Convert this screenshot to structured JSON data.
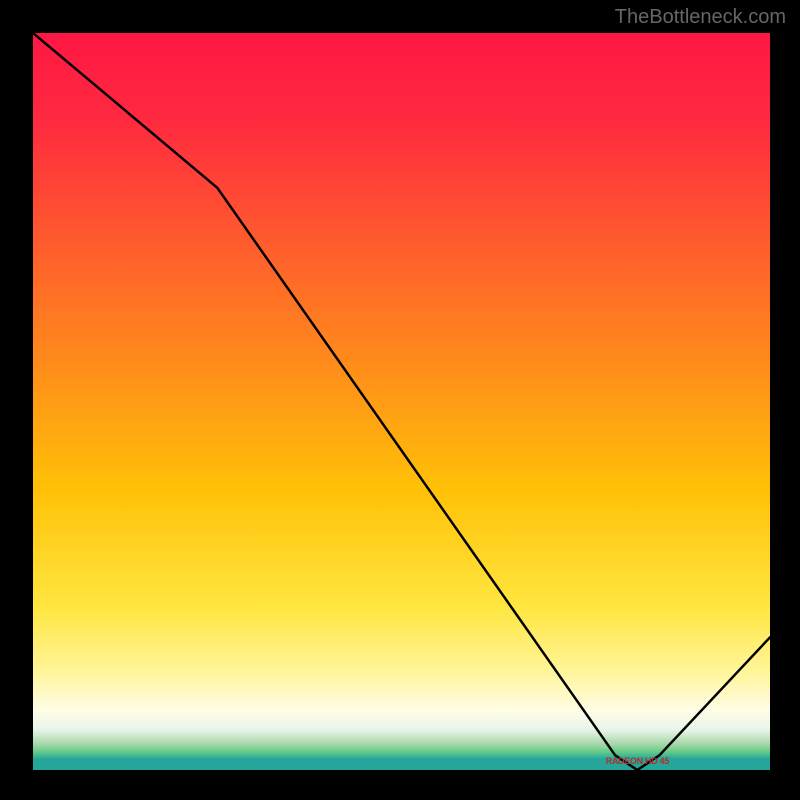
{
  "watermark": "TheBottleneck.com",
  "marker": {
    "label": "RADEON HD 45",
    "x_pct": 82
  },
  "chart_data": {
    "type": "line",
    "title": "",
    "xlabel": "",
    "ylabel": "",
    "xlim": [
      0,
      100
    ],
    "ylim": [
      0,
      100
    ],
    "x": [
      0,
      25,
      79,
      82,
      85,
      100
    ],
    "values": [
      100,
      79,
      2,
      0,
      2,
      18
    ],
    "annotations": [
      {
        "text": "RADEON HD 45",
        "x": 82,
        "y": 0
      }
    ],
    "gradient_stops": [
      {
        "pos": 0.0,
        "color": "#ff1744"
      },
      {
        "pos": 0.12,
        "color": "#ff2a3f"
      },
      {
        "pos": 0.28,
        "color": "#ff5a2e"
      },
      {
        "pos": 0.45,
        "color": "#ff8c1a"
      },
      {
        "pos": 0.62,
        "color": "#ffc107"
      },
      {
        "pos": 0.78,
        "color": "#ffe640"
      },
      {
        "pos": 0.87,
        "color": "#fff59d"
      },
      {
        "pos": 0.92,
        "color": "#fffde7"
      },
      {
        "pos": 0.945,
        "color": "#e8f5e9"
      },
      {
        "pos": 0.955,
        "color": "#c8e6c9"
      },
      {
        "pos": 0.965,
        "color": "#a5d6a7"
      },
      {
        "pos": 0.975,
        "color": "#66cc88"
      },
      {
        "pos": 0.985,
        "color": "#26a69a"
      },
      {
        "pos": 1.0,
        "color": "#26a69a"
      }
    ]
  }
}
